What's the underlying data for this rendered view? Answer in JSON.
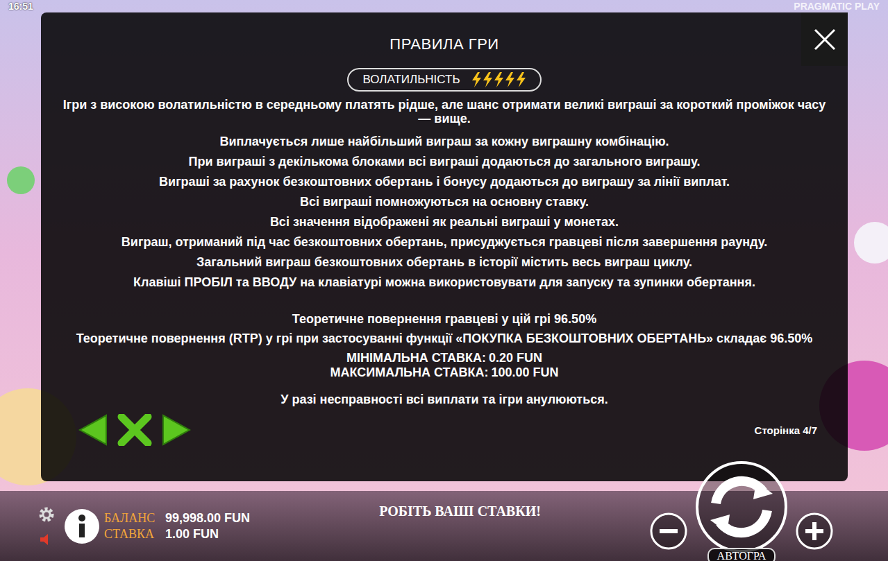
{
  "status": {
    "time": "16:51",
    "brand": "PRAGMATIC PLAY"
  },
  "rules": {
    "title": "ПРАВИЛА ГРИ",
    "volatility": {
      "label": "ВОЛАТИЛЬНІСТЬ",
      "stars": 5
    },
    "paragraphs": [
      "Ігри з високою волатильністю в середньому платять рідше, але шанс отримати великі виграші за короткий проміжок часу — вище.",
      "Виплачується лише найбільший виграш за кожну виграшну комбінацію.",
      "При виграші з декількома блоками всі виграші додаються до загального виграшу.",
      "Виграші за рахунок безкоштовних обертань і бонусу додаються до виграшу за лінії виплат.",
      "Всі виграші помножуються на основну ставку.",
      "Всі значення відображені як реальні виграші у монетах.",
      "Виграш, отриманий під час безкоштовних обертань, присуджується гравцеві після завершення раунду.",
      "Загальний виграш безкоштовних обертань в історії містить весь виграш циклу.",
      "Клавіші ПРОБІЛ та ВВОДУ на клавіатурі можна використовувати для запуску та зупинки обертання."
    ],
    "rtp": [
      "Теоретичне повернення гравцеві у цій грі 96.50%",
      "Теоретичне повернення (RTP) у грі при застосуванні функції «ПОКУПКА БЕЗКОШТОВНИХ ОБЕРТАНЬ» складає 96.50%"
    ],
    "bets": [
      {
        "label": "МІНІМАЛЬНА СТАВКА:",
        "value": "0.20 FUN"
      },
      {
        "label": "МАКСИМАЛЬНА СТАВКА:",
        "value": "100.00 FUN"
      }
    ],
    "disclaimer": "У разі несправності всі виплати та ігри анулюються.",
    "page": "Сторінка 4/7"
  },
  "bottom_bar": {
    "balance_label": "БАЛАНС",
    "balance": "99,998.00 FUN",
    "bet_label": "СТАВКА",
    "bet": "1.00 FUN",
    "message": "РОБІТЬ ВАШІ СТАВКИ!",
    "autoplay": "АВТОГРА"
  }
}
